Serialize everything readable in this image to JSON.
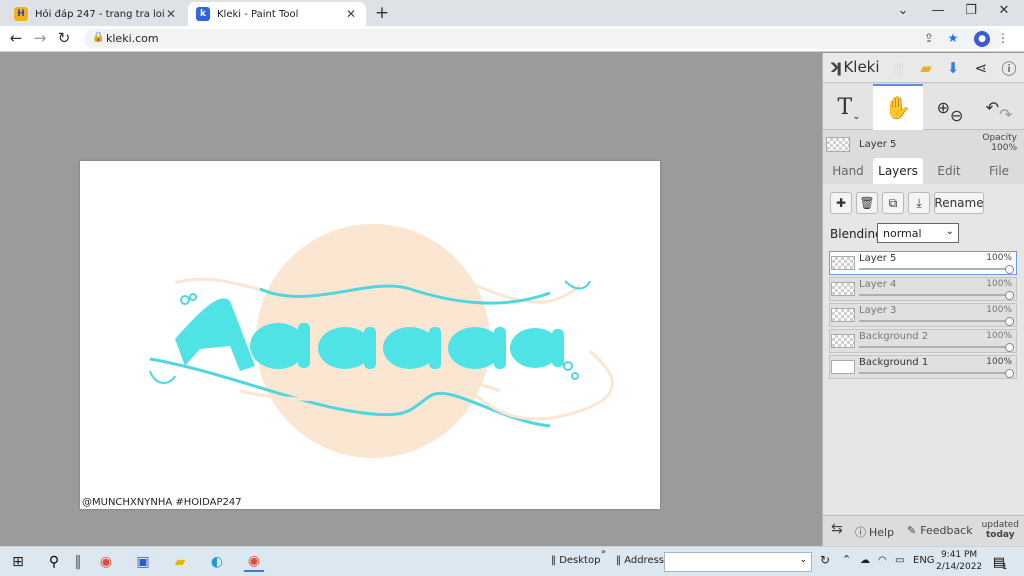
{
  "browser": {
    "tabs": [
      {
        "title": "Hỏi đáp 247 - trang tra loi",
        "favicon": "H",
        "active": false
      },
      {
        "title": "Kleki - Paint Tool",
        "favicon": "k",
        "active": true
      }
    ],
    "url": "kleki.com"
  },
  "canvas": {
    "watermark": "@MUNCHXNYNHA #HOIDAP247",
    "colors": {
      "circle": "#fbe6d2",
      "text": "#4fe3e6",
      "outline": "#4fd6e0",
      "background": "#ffffff"
    }
  },
  "panel": {
    "logo": "Kleki",
    "current_layer": {
      "name": "Layer 5",
      "opacity_label": "Opacity",
      "opacity": "100%"
    },
    "tabs": [
      "Hand",
      "Layers",
      "Edit",
      "File"
    ],
    "active_tab": "Layers",
    "buttons": {
      "rename": "Rename"
    },
    "blending": {
      "label": "Blending",
      "value": "normal"
    },
    "layers": [
      {
        "name": "Layer 5",
        "opacity": "100%",
        "selected": true
      },
      {
        "name": "Layer 4",
        "opacity": "100%",
        "selected": false
      },
      {
        "name": "Layer 3",
        "opacity": "100%",
        "selected": false
      },
      {
        "name": "Background 2",
        "opacity": "100%",
        "selected": false
      },
      {
        "name": "Background 1",
        "opacity": "100%",
        "selected": false
      }
    ],
    "footer": {
      "help": "Help",
      "feedback": "Feedback",
      "updated_line1": "updated",
      "updated_line2": "today"
    }
  },
  "taskbar": {
    "desktop": "Desktop",
    "address": "Address",
    "lang": "ENG",
    "time": "9:41 PM",
    "date": "2/14/2022",
    "notifications": "1"
  }
}
